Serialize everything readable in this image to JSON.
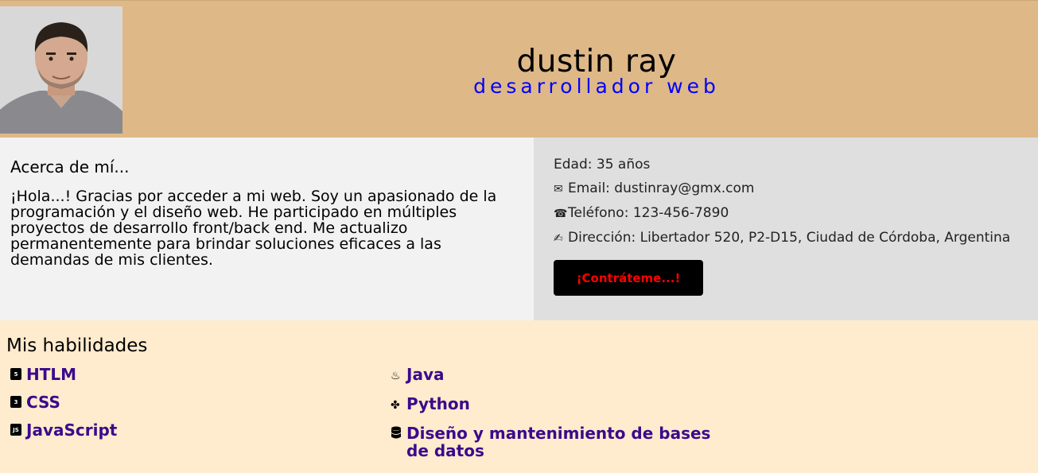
{
  "header": {
    "name": "dustin ray",
    "role": "desarrollador web"
  },
  "about": {
    "title": "Acerca de mí...",
    "text": "¡Hola...! Gracias por acceder a mi web. Soy un apasionado de la programación y el diseño web. He participado en múltiples proyectos de desarrollo front/back end. Me actualizo permanentemente para brindar soluciones eficaces a las demandas de mis clientes."
  },
  "contact": {
    "age": "Edad: 35 años",
    "email": "Email: dustinray@gmx.com",
    "phone": "Teléfono: 123-456-7890",
    "address": "Dirección: Libertador 520, P2-D15, Ciudad de Córdoba, Argentina",
    "icons": {
      "email": "envelope-icon",
      "phone": "telephone-icon",
      "address": "writing-hand-icon"
    },
    "hire_button": "¡Contráteme...!"
  },
  "skills": {
    "title": "Mis habilidades",
    "left": [
      {
        "label": "HTLM",
        "icon": "html5-icon"
      },
      {
        "label": "CSS",
        "icon": "css3-icon"
      },
      {
        "label": "JavaScript",
        "icon": "js-icon"
      }
    ],
    "right": [
      {
        "label": "Java",
        "icon": "java-icon"
      },
      {
        "label": "Python",
        "icon": "python-icon"
      },
      {
        "label": "Diseño y mantenimiento de bases de datos",
        "icon": "database-icon"
      }
    ]
  },
  "colors": {
    "header_bg": "#deb887",
    "role": "#0000ff",
    "skill_text": "#3a0a8c",
    "hire_text": "#ff0000",
    "skills_bg": "#ffebcd"
  }
}
